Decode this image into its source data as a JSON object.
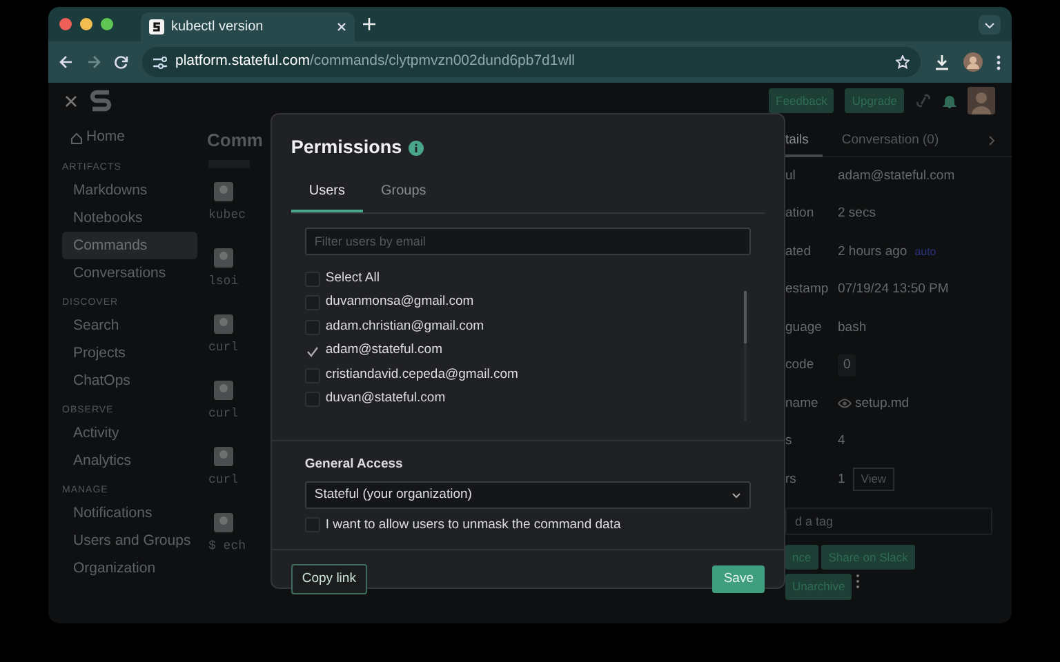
{
  "browser": {
    "tabs": [
      {
        "title": "kubectl version",
        "selected": true
      }
    ],
    "url_host": "platform.stateful.com",
    "url_path": "/commands/clytpmvzn002dund6pb7d1wll"
  },
  "header": {
    "buttons": [
      "Feedback",
      "Upgrade"
    ]
  },
  "sidebar": {
    "items": [
      {
        "kind": "link",
        "label": "Home",
        "selected": false
      },
      {
        "kind": "section",
        "label": "ARTIFACTS"
      },
      {
        "kind": "link",
        "label": "Markdowns",
        "selected": false
      },
      {
        "kind": "link",
        "label": "Notebooks",
        "selected": false
      },
      {
        "kind": "link",
        "label": "Commands",
        "selected": true
      },
      {
        "kind": "link",
        "label": "Conversations",
        "selected": false
      },
      {
        "kind": "section",
        "label": "DISCOVER"
      },
      {
        "kind": "link",
        "label": "Search",
        "selected": false
      },
      {
        "kind": "link",
        "label": "Projects",
        "selected": false
      },
      {
        "kind": "link",
        "label": "ChatOps",
        "selected": false
      },
      {
        "kind": "section",
        "label": "OBSERVE"
      },
      {
        "kind": "link",
        "label": "Activity",
        "selected": false
      },
      {
        "kind": "link",
        "label": "Analytics",
        "selected": false
      },
      {
        "kind": "section",
        "label": "MANAGE"
      },
      {
        "kind": "link",
        "label": "Notifications",
        "selected": false
      },
      {
        "kind": "link",
        "label": "Users and Groups",
        "selected": false
      },
      {
        "kind": "link",
        "label": "Organization",
        "selected": false
      }
    ]
  },
  "main": {
    "title": "Comm",
    "rows": [
      {
        "code": "kubec"
      },
      {
        "code": "lsoi"
      },
      {
        "code": "curl"
      },
      {
        "code": "curl"
      },
      {
        "code": "curl"
      },
      {
        "code": "$ ech"
      }
    ]
  },
  "modal": {
    "title": "Permissions",
    "tabs": [
      {
        "label": "Users",
        "selected": true
      },
      {
        "label": "Groups",
        "selected": false
      }
    ],
    "filter": {
      "placeholder": "Filter users by email"
    },
    "select_all": {
      "label": "Select All",
      "checked": false
    },
    "users": [
      {
        "email": "duvanmonsa@gmail.com",
        "checked": false
      },
      {
        "email": "adam.christian@gmail.com",
        "checked": false
      },
      {
        "email": "adam@stateful.com",
        "checked": true
      },
      {
        "email": "cristiandavid.cepeda@gmail.com",
        "checked": false
      },
      {
        "email": "duvan@stateful.com",
        "checked": false
      }
    ],
    "general_access": {
      "label": "General Access",
      "value": "Stateful (your organization)"
    },
    "unmask": {
      "label": "I want to allow users to unmask the command data",
      "checked": false
    },
    "copy_link": "Copy link",
    "save": "Save"
  },
  "details": {
    "tabs": [
      {
        "label": "tails",
        "selected": true
      },
      {
        "label": "Conversation (0)",
        "selected": false
      }
    ],
    "fields": [
      {
        "kind": "text",
        "label": "ul",
        "value": "adam@stateful.com"
      },
      {
        "kind": "badge",
        "label": "ation",
        "value": "2 secs"
      },
      {
        "kind": "badge",
        "label": "ated",
        "value": "2 hours ago",
        "badge": "auto"
      },
      {
        "kind": "text",
        "label": "estamp",
        "value": "07/19/24 13:50 PM"
      },
      {
        "kind": "text",
        "label": "guage",
        "value": "bash"
      },
      {
        "kind": "code",
        "label": "code",
        "value": "0"
      },
      {
        "kind": "file",
        "label": "name",
        "value": "setup.md"
      },
      {
        "kind": "text",
        "label": "s",
        "value": "4"
      },
      {
        "kind": "view",
        "label": "rs",
        "value": "1",
        "button": "View"
      }
    ],
    "tag": {
      "placeholder": "d a tag"
    },
    "buttons": [
      "nce",
      "Share on Slack",
      "Unarchive"
    ]
  }
}
